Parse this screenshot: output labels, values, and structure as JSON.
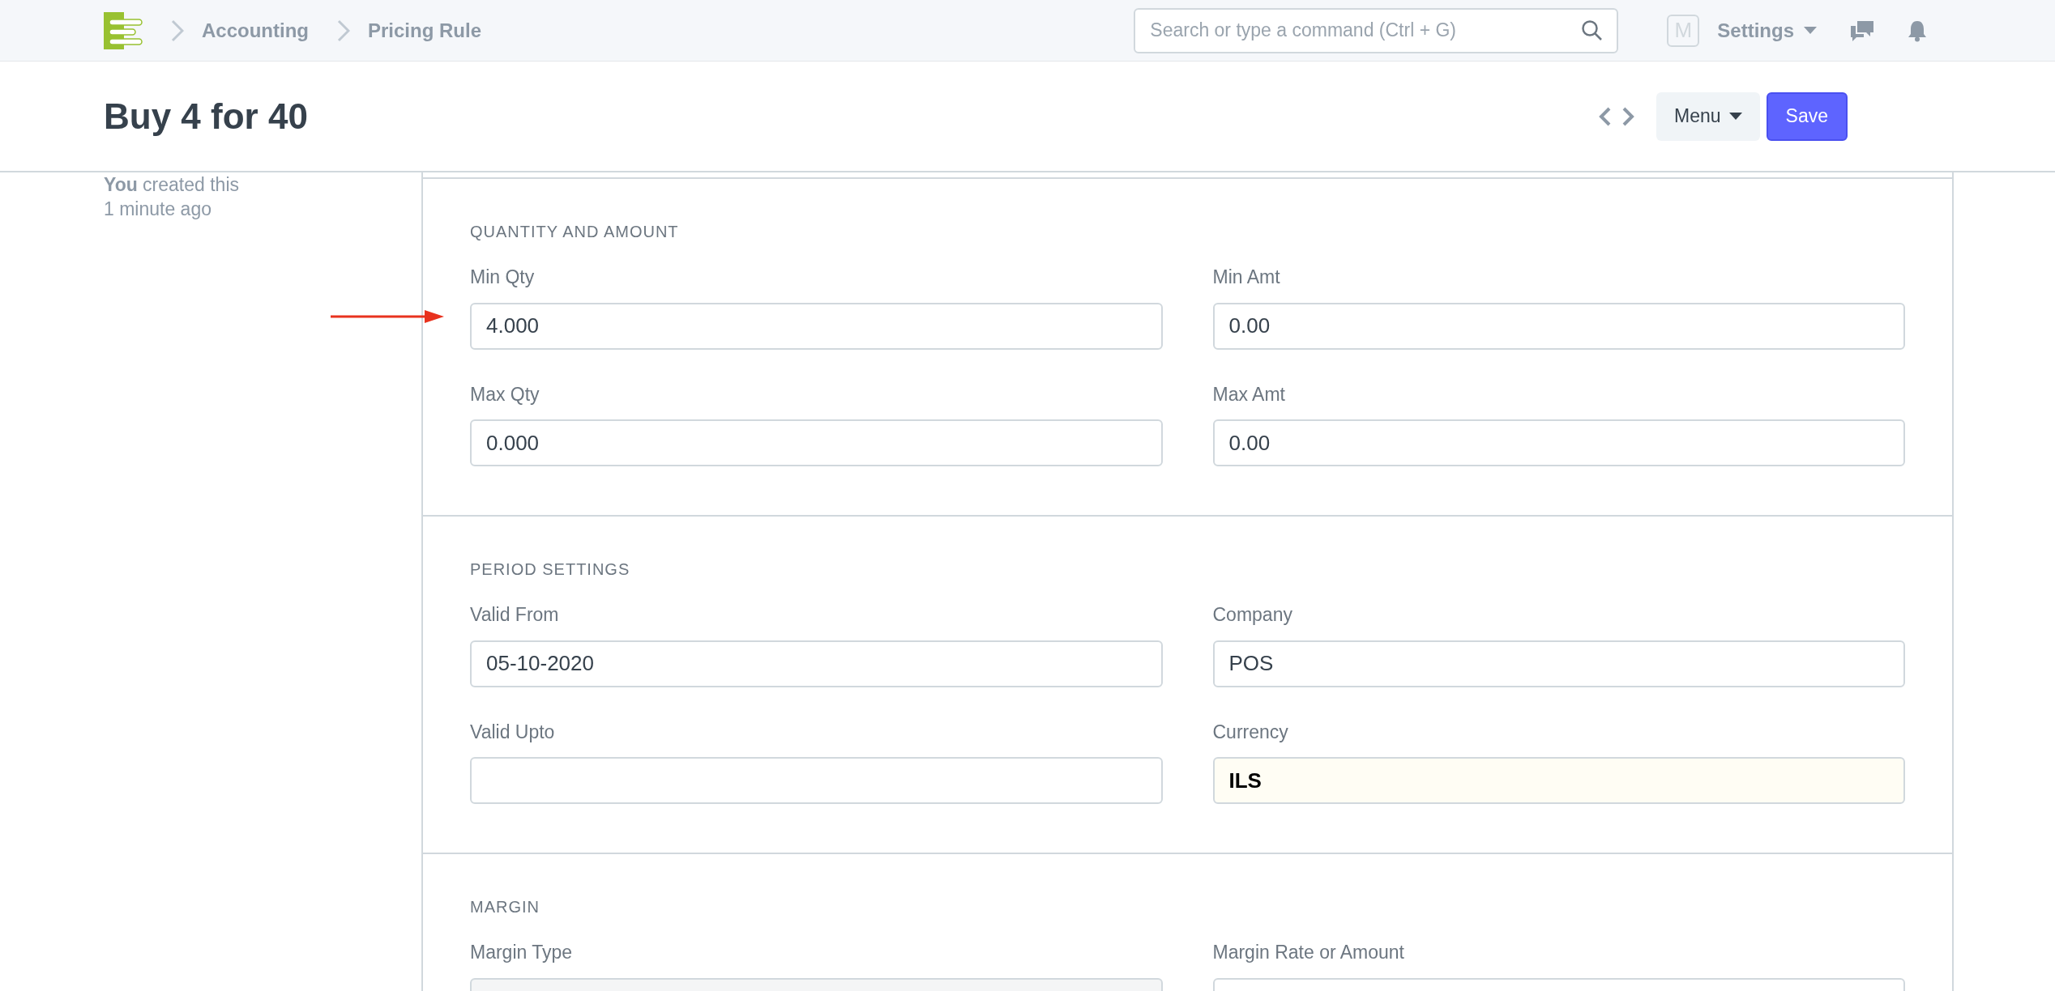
{
  "navbar": {
    "breadcrumbs": [
      "Accounting",
      "Pricing Rule"
    ],
    "search": {
      "placeholder": "Search or type a command (Ctrl + G)"
    },
    "avatar": "M",
    "settings": "Settings"
  },
  "page": {
    "title": "Buy 4 for 40",
    "menu": "Menu",
    "save": "Save"
  },
  "sidebar": {
    "created": "**You** created this",
    "time": "1 minute ago"
  },
  "sections": [
    {
      "heading": "QUANTITY AND AMOUNT",
      "fields": [
        {
          "label": "Min Qty",
          "value": "4.000",
          "kind": "text"
        },
        {
          "label": "Min Amt",
          "value": "0.00",
          "kind": "text"
        },
        {
          "label": "Max Qty",
          "value": "0.000",
          "kind": "text"
        },
        {
          "label": "Max Amt",
          "value": "0.00",
          "kind": "text"
        }
      ]
    },
    {
      "heading": "PERIOD SETTINGS",
      "fields": [
        {
          "label": "Valid From",
          "value": "05-10-2020",
          "kind": "text"
        },
        {
          "label": "Company",
          "value": "POS",
          "kind": "text"
        },
        {
          "label": "Valid Upto",
          "kind": "text"
        },
        {
          "label": "Currency",
          "value": "ILS",
          "kind": "fetched"
        }
      ]
    },
    {
      "heading": "MARGIN",
      "fields": [
        {
          "label": "Margin Type",
          "kind": "select"
        },
        {
          "label": "Margin Rate or Amount",
          "kind": "text"
        }
      ]
    }
  ]
}
